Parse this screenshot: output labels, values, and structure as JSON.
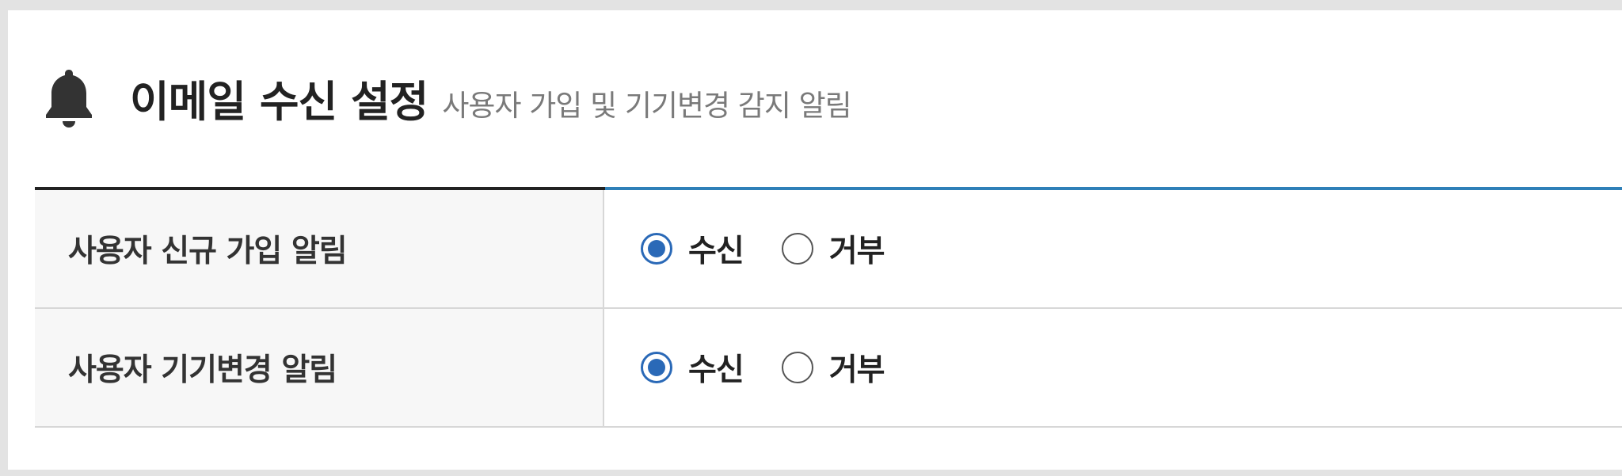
{
  "header": {
    "icon": "bell-icon",
    "title": "이메일 수신 설정",
    "subtitle": "사용자 가입 및 기기변경 감지 알림"
  },
  "colors": {
    "accent": "#2a69b7",
    "table_top_dark": "#222222",
    "table_top_accent": "#2f80b8"
  },
  "settings": [
    {
      "label": "사용자 신규 가입 알림",
      "options": [
        {
          "label": "수신",
          "checked": true
        },
        {
          "label": "거부",
          "checked": false
        }
      ]
    },
    {
      "label": "사용자 기기변경 알림",
      "options": [
        {
          "label": "수신",
          "checked": true
        },
        {
          "label": "거부",
          "checked": false
        }
      ]
    }
  ]
}
